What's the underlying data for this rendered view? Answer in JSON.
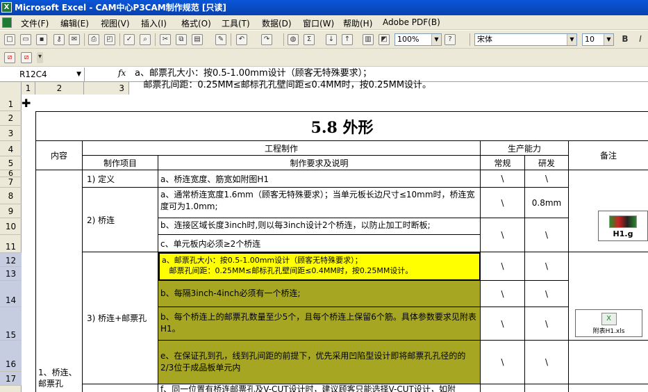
{
  "window": {
    "title": "Microsoft Excel - CAM中心P3CAM制作规范 [只读]"
  },
  "menu": [
    "文件(F)",
    "编辑(E)",
    "视图(V)",
    "插入(I)",
    "格式(O)",
    "工具(T)",
    "数据(D)",
    "窗口(W)",
    "帮助(H)",
    "Adobe PDF(B)"
  ],
  "toolbar": {
    "zoom": "100%",
    "font": "宋体",
    "size": "10",
    "bold": "B",
    "italic": "I"
  },
  "formula": {
    "namebox": "R12C4",
    "fx": "fx",
    "line1": "a、邮票孔大小：按0.5-1.00mm设计（顾客无特殊要求）；",
    "line2": "   邮票孔间距：0.25MM≤邮标孔孔壁间距≤0.4MM时，按0.25MM设计。"
  },
  "outline": {
    "levels": [
      "1",
      "2",
      "3"
    ]
  },
  "rows": [
    "1",
    "2",
    "3",
    "4",
    "5",
    "6",
    "7",
    "8",
    "9",
    "10",
    "11",
    "12",
    "13",
    "14",
    "15",
    "16",
    "17"
  ],
  "sheet": {
    "title": "5.8 外形",
    "h_content": "内容",
    "h_process": "工程制作",
    "h_capacity": "生产能力",
    "h_notes": "备注",
    "h_item": "制作项目",
    "h_req": "制作要求及说明",
    "h_normal": "常规",
    "h_rd": "研发",
    "cat1": "1、桥连、邮票孔",
    "item_def": "1) 定义",
    "item_bridge": "2) 桥连",
    "item_stamp": "3) 桥连+邮票孔",
    "r_def": "a、桥连宽度、筋宽如附图H1",
    "r_b1": "a、通常桥连宽度1.6mm（顾客无特殊要求）；当单元板长边尺寸≤10mm时，桥连宽度可为1.0mm;",
    "r_b2": "b、连接区域长度3inch时,则以每3inch设计2个桥连，以防止加工时断板;",
    "r_b3": "c、单元板内必须≥2个桥连",
    "r_s1": "a、邮票孔大小：按0.5-1.00mm设计（顾客无特殊要求）；\n   邮票孔间距：0.25MM≤邮标孔孔壁间距≤0.4MM时，按0.25MM设计。",
    "r_s2": "b、每隔3inch-4inch必须有一个桥连;",
    "r_s3": "b、每个桥连上的邮票孔数量至少5个，且每个桥连上保留6个筋。具体参数要求见附表H1。",
    "r_s4": "e、在保证孔到孔，线到孔间距的前提下，优先采用凹陷型设计即将邮票孔孔径的的2/3位于成品板单元内",
    "r_s5": "f、同一位置有桥连邮票孔及V-CUT设计时，建议顾客只能选择V-CUT设计，如附",
    "bs": "\\",
    "rd_08": "0.8mm",
    "embed1": "H1.g",
    "embed2": "附表H1.xls"
  }
}
